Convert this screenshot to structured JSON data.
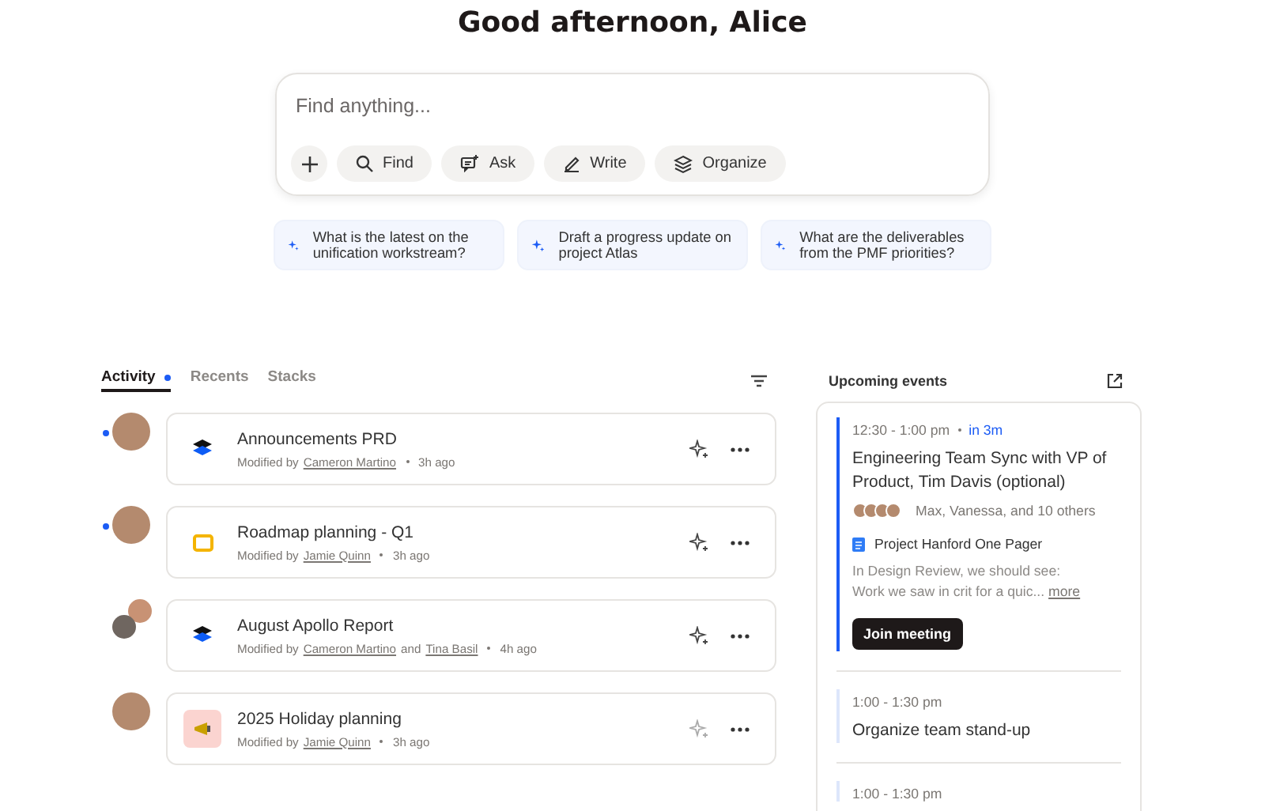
{
  "greeting": "Good afternoon, Alice",
  "search": {
    "placeholder": "Find anything...",
    "actions": [
      {
        "kind": "add"
      },
      {
        "kind": "find",
        "label": "Find"
      },
      {
        "kind": "ask",
        "label": "Ask"
      },
      {
        "kind": "write",
        "label": "Write"
      },
      {
        "kind": "organize",
        "label": "Organize"
      }
    ]
  },
  "suggestions": [
    "What is the latest on the unification workstream?",
    "Draft a progress update on project Atlas",
    "What are the deliverables from the PMF priorities?"
  ],
  "tabs": [
    {
      "label": "Activity",
      "selected": true,
      "dot": true
    },
    {
      "label": "Recents",
      "selected": false,
      "dot": false
    },
    {
      "label": "Stacks",
      "selected": false,
      "dot": false
    }
  ],
  "activity": [
    {
      "title": "Announcements PRD",
      "kind": "stack",
      "unread": true,
      "shared": false,
      "prefix": "Modified by",
      "people": [
        "Cameron Martino"
      ],
      "time": "3h ago"
    },
    {
      "title": "Roadmap planning - Q1",
      "kind": "slides",
      "unread": true,
      "shared": false,
      "prefix": "Modified by",
      "people": [
        "Jamie Quinn"
      ],
      "time": "3h ago"
    },
    {
      "title": "August Apollo Report",
      "kind": "stack",
      "unread": false,
      "shared": true,
      "prefix": "Modified by",
      "people": [
        "Cameron Martino",
        "Tina Basil"
      ],
      "joiner": "and",
      "time": "4h ago"
    },
    {
      "title": "2025 Holiday planning",
      "kind": "holiday",
      "unread": false,
      "shared": false,
      "prefix": "Modified by",
      "people": [
        "Jamie Quinn"
      ],
      "time": "3h ago"
    }
  ],
  "events": {
    "title": "Upcoming events",
    "items": [
      {
        "time": "12:30 - 1:00 pm",
        "relative": "in 3m",
        "title": "Engineering Team Sync with VP of Product, Tim Davis (optional)",
        "active": true,
        "attendees": "Max, Vanessa, and 10 others",
        "attachment": "Project Hanford One Pager",
        "description": [
          "In Design Review, we should see:",
          "Work we saw in crit for a quic..."
        ],
        "more": "more",
        "button": "Join meeting"
      },
      {
        "time": "1:00 - 1:30 pm",
        "title": "Organize team stand-up",
        "active": false
      },
      {
        "time": "1:00 - 1:30 pm",
        "active": false
      }
    ]
  }
}
